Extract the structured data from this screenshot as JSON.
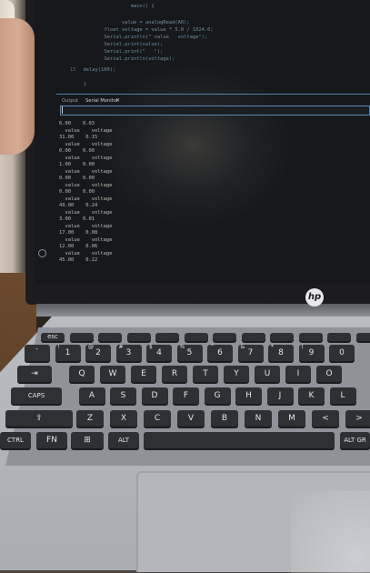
{
  "editor": {
    "code_lines": [
      "           main() {",
      "        value = analogRead(A0);",
      "  float voltage = value * 5.0 / 1024.0;",
      "  Serial.println(\" value   voltage\");",
      "  Serial.print(value);",
      "  Serial.print(\"   \");",
      "  Serial.println(voltage);"
    ],
    "delay_line": "  delay(100);",
    "close_brace": "}",
    "line_number": "15"
  },
  "panel": {
    "tab_output": "Output",
    "tab_serial": "Serial Monitor",
    "tab_close": "✕",
    "input_value": ""
  },
  "serial_output": [
    "6.00    0.03",
    "  value    voltage",
    "31.00    0.15",
    "  value    voltage",
    "0.00    0.00",
    "  value    voltage",
    "1.00    0.00",
    "  value    voltage",
    "0.00    0.00",
    "  value    voltage",
    "0.00    0.00",
    "  value    voltage",
    "49.00    0.24",
    "  value    voltage",
    "3.00    0.01",
    "  value    voltage",
    "17.00    0.08",
    "  value    voltage",
    "12.00    0.06",
    "  value    voltage",
    "45.00    0.22"
  ],
  "logo": "hp",
  "keyboard": {
    "row_fn": [
      "esc",
      "",
      "",
      "",
      "",
      "",
      "",
      "",
      "",
      "",
      "",
      ""
    ],
    "row_num": [
      {
        "top": "",
        "main": "`"
      },
      {
        "top": "!",
        "main": "1"
      },
      {
        "top": "@",
        "main": "2"
      },
      {
        "top": "#",
        "main": "3"
      },
      {
        "top": "$",
        "main": "4"
      },
      {
        "top": "%",
        "main": "5"
      },
      {
        "top": "^",
        "main": "6"
      },
      {
        "top": "&",
        "main": "7"
      },
      {
        "top": "*",
        "main": "8"
      },
      {
        "top": "(",
        "main": "9"
      },
      {
        "top": "",
        "main": "0"
      }
    ],
    "row_q": [
      "⇥",
      "Q",
      "W",
      "E",
      "R",
      "T",
      "Y",
      "U",
      "I",
      "O"
    ],
    "row_a": [
      "CAPS",
      "A",
      "S",
      "D",
      "F",
      "G",
      "H",
      "J",
      "K",
      "L"
    ],
    "row_z": [
      "⇧",
      "Z",
      "X",
      "C",
      "V",
      "B",
      "N",
      "M",
      "<",
      ">"
    ],
    "row_bottom": [
      "CTRL",
      "FN",
      "⊞",
      "ALT",
      "",
      "ALT GR"
    ]
  }
}
